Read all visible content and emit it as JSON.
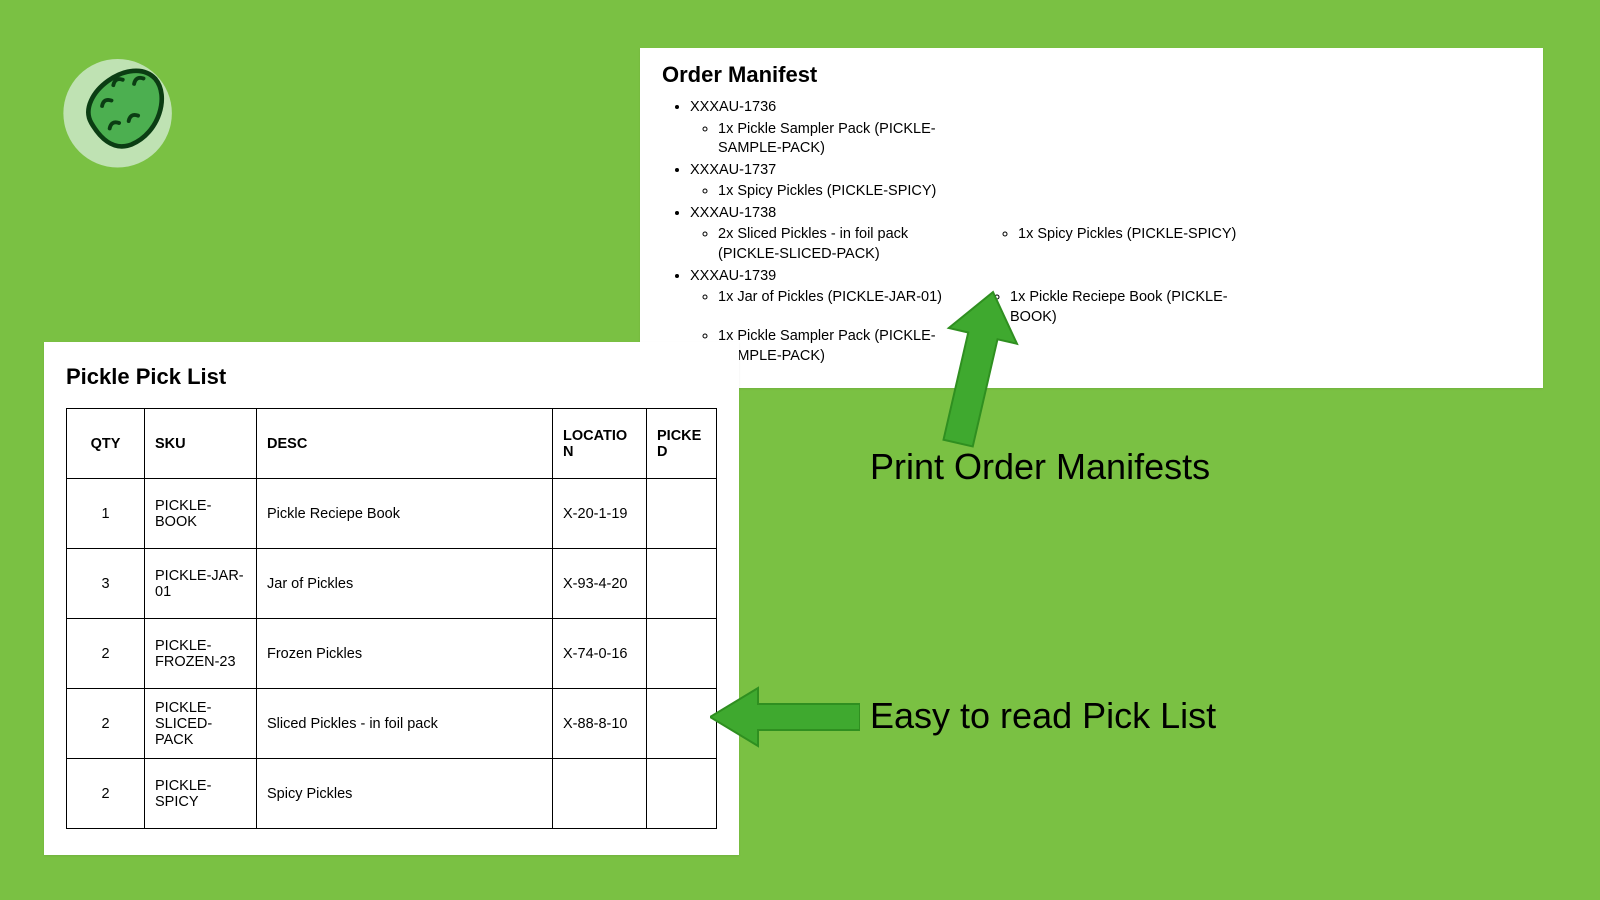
{
  "callouts": {
    "manifest": "Print Order Manifests",
    "picklist": "Easy to read Pick List"
  },
  "manifest": {
    "title": "Order Manifest",
    "orders": [
      {
        "id": "XXXAU-1736",
        "items": [
          "1x Pickle Sampler Pack (PICKLE-SAMPLE-PACK)"
        ]
      },
      {
        "id": "XXXAU-1737",
        "items": [
          "1x Spicy Pickles (PICKLE-SPICY)"
        ]
      },
      {
        "id": "XXXAU-1738",
        "items": [
          "2x Sliced Pickles - in foil pack (PICKLE-SLICED-PACK)",
          "1x Spicy Pickles (PICKLE-SPICY)"
        ]
      },
      {
        "id": "XXXAU-1739",
        "items": [
          "1x Jar of Pickles (PICKLE-JAR-01)",
          "1x Pickle Reciepe Book (PICKLE-BOOK)",
          "1x Pickle Sampler Pack (PICKLE-SAMPLE-PACK)"
        ]
      }
    ]
  },
  "picklist": {
    "title": "Pickle Pick List",
    "columns": [
      "QTY",
      "SKU",
      "DESC",
      "LOCATION",
      "PICKED"
    ],
    "rows": [
      {
        "qty": "1",
        "sku": "PICKLE-BOOK",
        "desc": "Pickle Reciepe Book",
        "location": "X-20-1-19",
        "picked": ""
      },
      {
        "qty": "3",
        "sku": "PICKLE-JAR-01",
        "desc": "Jar of Pickles",
        "location": "X-93-4-20",
        "picked": ""
      },
      {
        "qty": "2",
        "sku": "PICKLE-FROZEN-23",
        "desc": "Frozen Pickles",
        "location": "X-74-0-16",
        "picked": ""
      },
      {
        "qty": "2",
        "sku": "PICKLE-SLICED-PACK",
        "desc": "Sliced Pickles - in foil pack",
        "location": "X-88-8-10",
        "picked": ""
      },
      {
        "qty": "2",
        "sku": "PICKLE-SPICY",
        "desc": "Spicy Pickles",
        "location": "",
        "picked": ""
      }
    ]
  }
}
